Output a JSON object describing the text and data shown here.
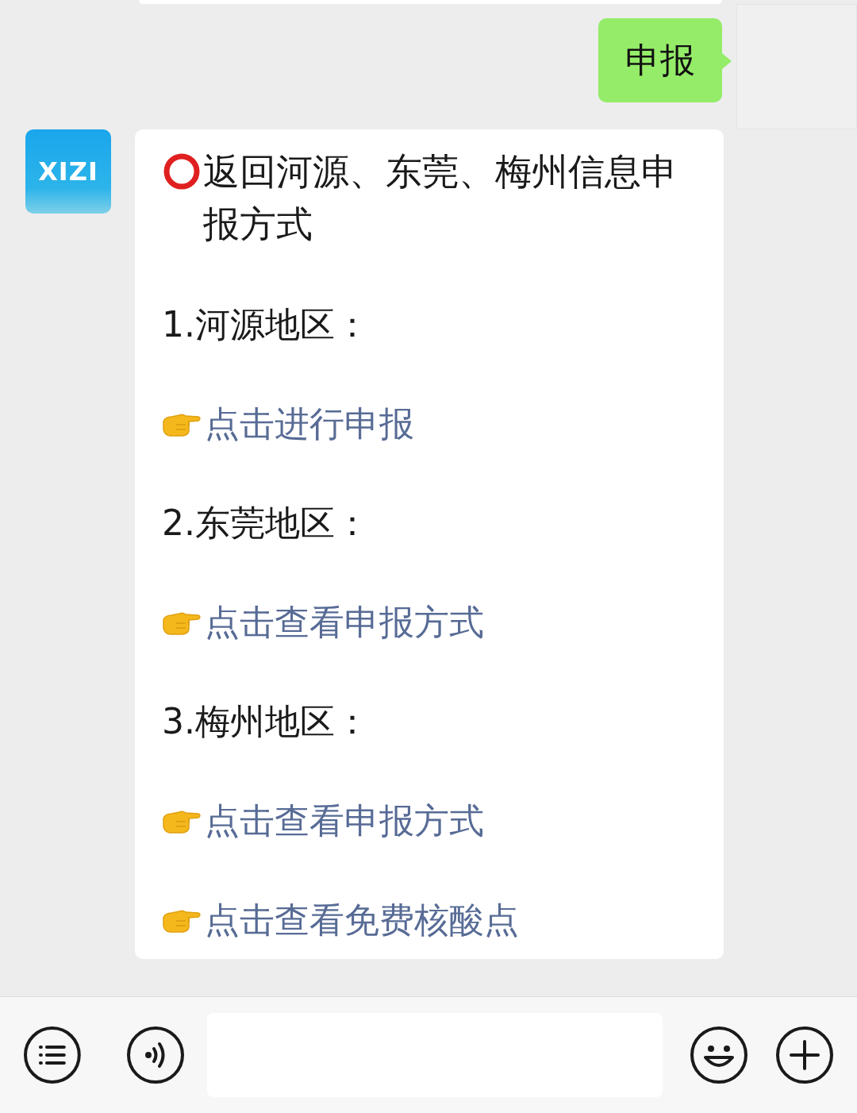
{
  "messages": [
    {
      "kind": "outgoing",
      "text": "申报"
    },
    {
      "kind": "incoming",
      "avatar": "XIZI",
      "lines": [
        {
          "kind": "title",
          "text": "返回河源、东莞、梅州信息申报方式"
        },
        {
          "kind": "text",
          "text": "1.河源地区："
        },
        {
          "kind": "link",
          "text": "点击进行申报"
        },
        {
          "kind": "text",
          "text": "2.东莞地区："
        },
        {
          "kind": "link",
          "text": "点击查看申报方式"
        },
        {
          "kind": "text",
          "text": "3.梅州地区："
        },
        {
          "kind": "link",
          "text": "点击查看申报方式"
        },
        {
          "kind": "link",
          "text": "点击查看免费核酸点"
        }
      ]
    }
  ]
}
